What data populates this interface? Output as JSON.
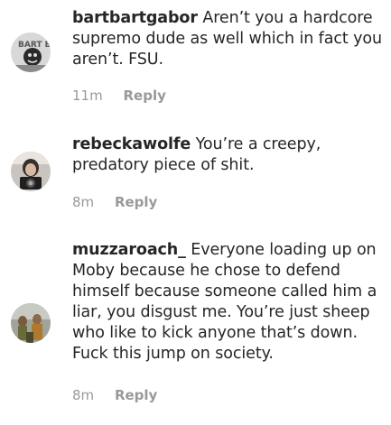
{
  "comments": [
    {
      "username": "bartbartgabor",
      "text": " Aren’t you a hardcore supremo dude as well which in fact you aren’t. FSU.",
      "time": "11m",
      "reply_label": "Reply",
      "avatar_icon": "user-avatar-bart-icon",
      "avatar_text": "BART BART"
    },
    {
      "username": "rebeckawolfe",
      "text": " You’re a creepy, predatory piece of shit.",
      "time": "8m",
      "reply_label": "Reply",
      "avatar_icon": "user-avatar-camera-icon"
    },
    {
      "username": "muzzaroach_",
      "text": " Everyone loading up on Moby because he chose to defend himself because someone called him a liar, you disgust me. You’re just sheep who like to kick anyone that’s down. Fuck this jump on society.",
      "time": "8m",
      "reply_label": "Reply",
      "avatar_icon": "user-avatar-group-icon"
    }
  ]
}
